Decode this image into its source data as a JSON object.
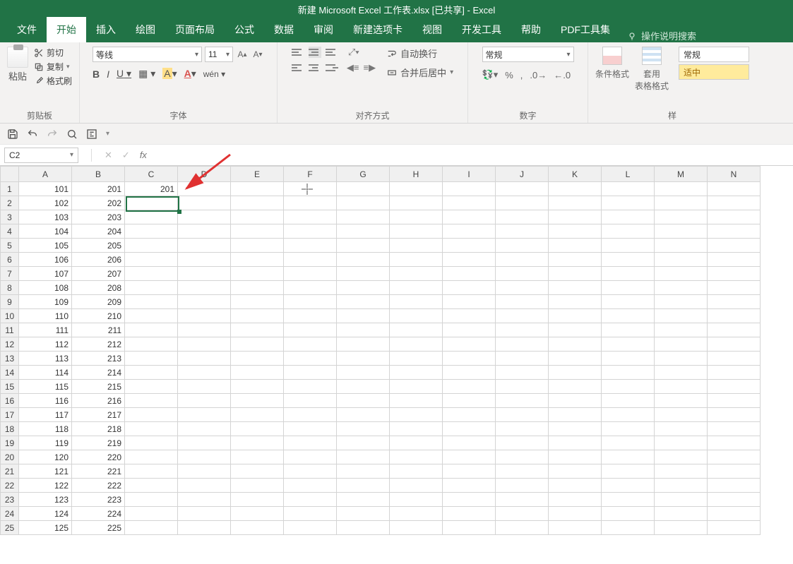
{
  "title": "新建 Microsoft Excel 工作表.xlsx  [已共享]  -  Excel",
  "tabs": [
    "文件",
    "开始",
    "插入",
    "绘图",
    "页面布局",
    "公式",
    "数据",
    "审阅",
    "新建选项卡",
    "视图",
    "开发工具",
    "帮助",
    "PDF工具集"
  ],
  "tell_me": "操作说明搜索",
  "clipboard": {
    "paste": "粘贴",
    "cut": "剪切",
    "copy": "复制",
    "format_painter": "格式刷",
    "label": "剪贴板"
  },
  "font": {
    "name": "等线",
    "size": "11",
    "label": "字体",
    "bold": "B",
    "italic": "I",
    "underline": "U"
  },
  "align": {
    "wrap": "自动换行",
    "merge": "合并后居中",
    "label": "对齐方式"
  },
  "number": {
    "format": "常规",
    "label": "数字"
  },
  "styles": {
    "cond": "条件格式",
    "table": "套用\n表格格式",
    "normal": "常规",
    "medium": "适中"
  },
  "name_box": "C2",
  "fx": "",
  "columns": [
    "A",
    "B",
    "C",
    "D",
    "E",
    "F",
    "G",
    "H",
    "I",
    "J",
    "K",
    "L",
    "M",
    "N"
  ],
  "rows": [
    {
      "n": 1,
      "A": "101",
      "B": "201",
      "C": "201"
    },
    {
      "n": 2,
      "A": "102",
      "B": "202",
      "C": ""
    },
    {
      "n": 3,
      "A": "103",
      "B": "203"
    },
    {
      "n": 4,
      "A": "104",
      "B": "204"
    },
    {
      "n": 5,
      "A": "105",
      "B": "205"
    },
    {
      "n": 6,
      "A": "106",
      "B": "206"
    },
    {
      "n": 7,
      "A": "107",
      "B": "207"
    },
    {
      "n": 8,
      "A": "108",
      "B": "208"
    },
    {
      "n": 9,
      "A": "109",
      "B": "209"
    },
    {
      "n": 10,
      "A": "110",
      "B": "210"
    },
    {
      "n": 11,
      "A": "111",
      "B": "211"
    },
    {
      "n": 12,
      "A": "112",
      "B": "212"
    },
    {
      "n": 13,
      "A": "113",
      "B": "213"
    },
    {
      "n": 14,
      "A": "114",
      "B": "214"
    },
    {
      "n": 15,
      "A": "115",
      "B": "215"
    },
    {
      "n": 16,
      "A": "116",
      "B": "216"
    },
    {
      "n": 17,
      "A": "117",
      "B": "217"
    },
    {
      "n": 18,
      "A": "118",
      "B": "218"
    },
    {
      "n": 19,
      "A": "119",
      "B": "219"
    },
    {
      "n": 20,
      "A": "120",
      "B": "220"
    },
    {
      "n": 21,
      "A": "121",
      "B": "221"
    },
    {
      "n": 22,
      "A": "122",
      "B": "222"
    },
    {
      "n": 23,
      "A": "123",
      "B": "223"
    },
    {
      "n": 24,
      "A": "124",
      "B": "224"
    },
    {
      "n": 25,
      "A": "125",
      "B": "225"
    }
  ],
  "selected_cell": "C2"
}
